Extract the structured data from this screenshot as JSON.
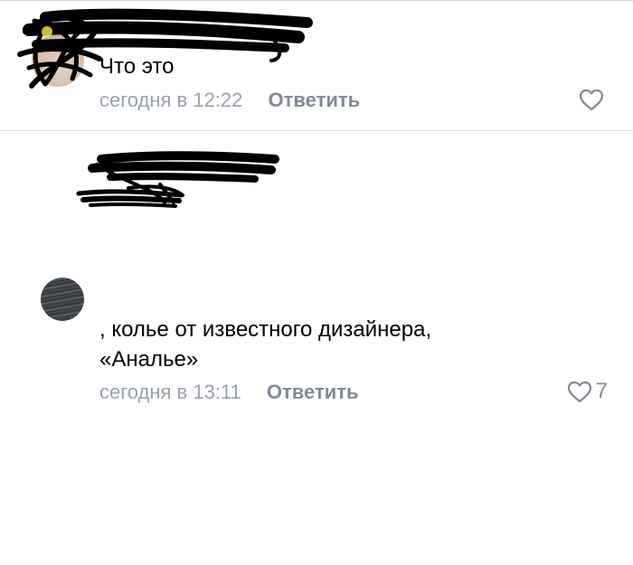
{
  "comments": [
    {
      "author": "",
      "text": "Что это",
      "time": "сегодня в 12:22",
      "reply_label": "Ответить",
      "likes": "",
      "icon": "heart-outline-icon"
    },
    {
      "author": "",
      "text": ", колье от известного дизайнера,\n«Аналье»",
      "time": "сегодня в 13:11",
      "reply_label": "Ответить",
      "likes": "7",
      "icon": "heart-outline-icon"
    }
  ],
  "colors": {
    "link": "#2a5885",
    "meta": "#99a2ad",
    "action": "#828a99",
    "divider": "#dcdde0",
    "redaction": "#000000"
  }
}
